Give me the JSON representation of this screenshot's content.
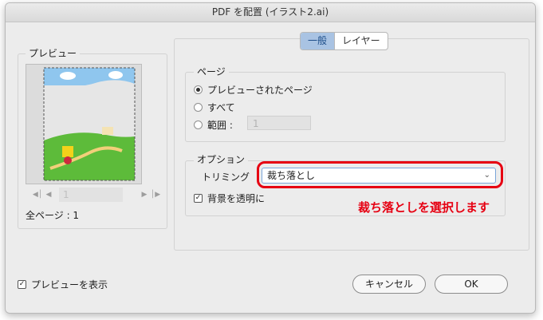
{
  "window": {
    "title": "PDF を配置 (イラスト2.ai)"
  },
  "tabs": [
    {
      "label": "一般",
      "active": true
    },
    {
      "label": "レイヤー",
      "active": false
    }
  ],
  "preview_panel": {
    "legend": "プレビュー",
    "page_field": "1",
    "page_count_text": "全ページ : 1",
    "nav_icons": [
      "first-page-icon",
      "prev-page-icon",
      "next-page-icon",
      "last-page-icon"
    ]
  },
  "page_group": {
    "legend": "ページ",
    "options": [
      {
        "label": "プレビューされたページ",
        "selected": true
      },
      {
        "label": "すべて",
        "selected": false
      },
      {
        "label": "範囲 :",
        "selected": false
      }
    ],
    "range_value": "1"
  },
  "options_group": {
    "legend": "オプション",
    "trim_label": "トリミング",
    "trim_value": "裁ち落とし",
    "transparent_bg_label": "背景を透明に",
    "transparent_bg_checked": true
  },
  "annotation": "裁ち落としを選択します",
  "footer": {
    "show_preview_label": "プレビューを表示",
    "show_preview_checked": true,
    "cancel_label": "キャンセル",
    "ok_label": "OK"
  },
  "colors": {
    "accent": "#e60012",
    "tab_active": "#a9c3e3"
  }
}
